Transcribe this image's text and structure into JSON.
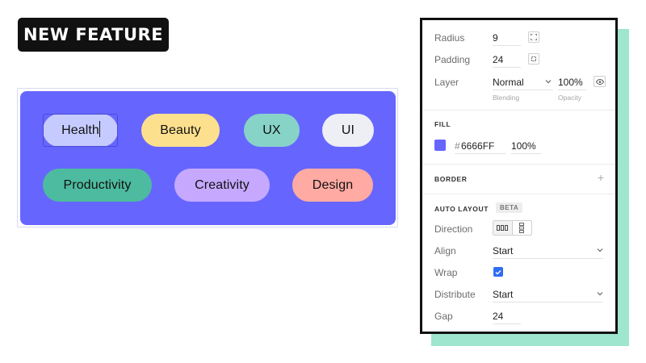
{
  "badge": {
    "text": "NEW FEATURE"
  },
  "canvas": {
    "tags": [
      {
        "label": "Health",
        "color": "#c5cbff"
      },
      {
        "label": "Beauty",
        "color": "#fde08e"
      },
      {
        "label": "UX",
        "color": "#88d3c7"
      },
      {
        "label": "UI",
        "color": "#eeeef5"
      },
      {
        "label": "Productivity",
        "color": "#4dbb9f"
      },
      {
        "label": "Creativity",
        "color": "#c6a9ff"
      },
      {
        "label": "Design",
        "color": "#ffaaa3"
      }
    ],
    "frame_color": "#6666FF"
  },
  "panel": {
    "radius": {
      "label": "Radius",
      "value": "9"
    },
    "padding": {
      "label": "Padding",
      "value": "24"
    },
    "layer": {
      "label": "Layer",
      "blending_value": "Normal",
      "blending_sub": "Blending",
      "opacity_value": "100%",
      "opacity_sub": "Opacity"
    },
    "fill": {
      "title": "FILL",
      "hash": "#",
      "hex": "6666FF",
      "opacity": "100%"
    },
    "border": {
      "title": "BORDER"
    },
    "auto_layout": {
      "title": "AUTO LAYOUT",
      "beta": "BETA",
      "direction_label": "Direction",
      "align_label": "Align",
      "align_value": "Start",
      "wrap_label": "Wrap",
      "wrap_checked": true,
      "distribute_label": "Distribute",
      "distribute_value": "Start",
      "gap_label": "Gap",
      "gap_value": "24"
    }
  }
}
